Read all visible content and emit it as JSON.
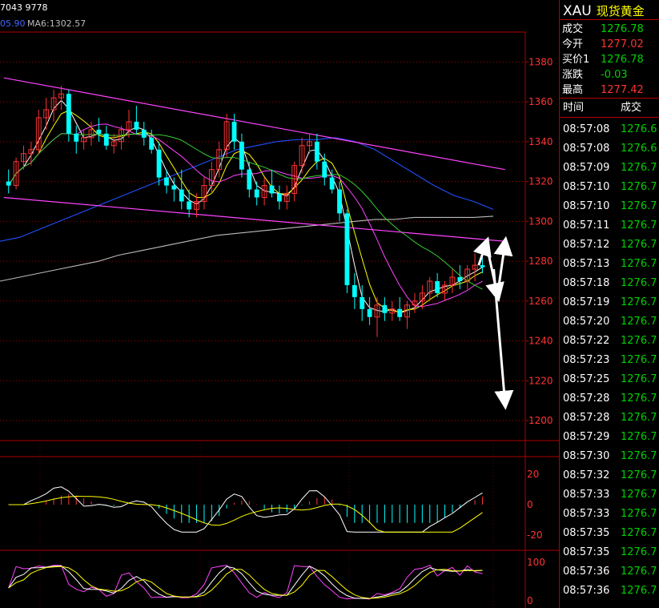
{
  "topbar": {
    "left_text": "7043 9778",
    "ma_partial": "05.90",
    "ma6": "MA6:1302.57"
  },
  "panel": {
    "symbol": "XAU",
    "name": "现货黄金",
    "quotes": [
      {
        "label": "成交",
        "value": "1276.78",
        "color": "#00d000"
      },
      {
        "label": "今开",
        "value": "1277.02",
        "color": "#ff3333"
      },
      {
        "label": "买价1",
        "value": "1276.78",
        "color": "#00d000"
      },
      {
        "label": "涨跌",
        "value": "-0.03",
        "color": "#00d000"
      },
      {
        "label": "最高",
        "value": "1277.42",
        "color": "#ff3333"
      }
    ],
    "tick_header": {
      "time": "时间",
      "price": "成交"
    },
    "ticks": [
      {
        "time": "08:57:08",
        "price": "1276.6"
      },
      {
        "time": "08:57:08",
        "price": "1276.6"
      },
      {
        "time": "08:57:09",
        "price": "1276.7"
      },
      {
        "time": "08:57:10",
        "price": "1276.7"
      },
      {
        "time": "08:57:10",
        "price": "1276.7"
      },
      {
        "time": "08:57:11",
        "price": "1276.7"
      },
      {
        "time": "08:57:12",
        "price": "1276.7"
      },
      {
        "time": "08:57:13",
        "price": "1276.7"
      },
      {
        "time": "08:57:18",
        "price": "1276.7"
      },
      {
        "time": "08:57:19",
        "price": "1276.7"
      },
      {
        "time": "08:57:20",
        "price": "1276.7"
      },
      {
        "time": "08:57:22",
        "price": "1276.7"
      },
      {
        "time": "08:57:23",
        "price": "1276.7"
      },
      {
        "time": "08:57:25",
        "price": "1276.7"
      },
      {
        "time": "08:57:28",
        "price": "1276.7"
      },
      {
        "time": "08:57:28",
        "price": "1276.7"
      },
      {
        "time": "08:57:29",
        "price": "1276.7"
      },
      {
        "time": "08:57:30",
        "price": "1276.7"
      },
      {
        "time": "08:57:32",
        "price": "1276.7"
      },
      {
        "time": "08:57:33",
        "price": "1276.7"
      },
      {
        "time": "08:57:33",
        "price": "1276.7"
      },
      {
        "time": "08:57:35",
        "price": "1276.7"
      },
      {
        "time": "08:57:35",
        "price": "1276.7"
      },
      {
        "time": "08:57:36",
        "price": "1276.7"
      },
      {
        "time": "08:57:36",
        "price": "1276.7"
      }
    ]
  },
  "chart_data": {
    "type": "candlestick",
    "price_axis": {
      "ticks": [
        "1380",
        "1360",
        "1340",
        "1320",
        "1300",
        "1280",
        "1260",
        "1240",
        "1220",
        "1200"
      ],
      "ylim": [
        1190,
        1395
      ]
    },
    "macd_axis": {
      "ticks": [
        "20",
        "0",
        "-20"
      ]
    },
    "osc_axis": {
      "ticks": [
        "100",
        "0"
      ]
    },
    "candles": [
      [
        1320,
        1326,
        1314,
        1318
      ],
      [
        1318,
        1332,
        1316,
        1330
      ],
      [
        1330,
        1338,
        1326,
        1334
      ],
      [
        1334,
        1340,
        1328,
        1336
      ],
      [
        1336,
        1356,
        1334,
        1352
      ],
      [
        1352,
        1362,
        1346,
        1356
      ],
      [
        1356,
        1366,
        1350,
        1362
      ],
      [
        1362,
        1368,
        1356,
        1364
      ],
      [
        1364,
        1366,
        1340,
        1344
      ],
      [
        1344,
        1348,
        1334,
        1340
      ],
      [
        1340,
        1346,
        1336,
        1342
      ],
      [
        1342,
        1350,
        1338,
        1346
      ],
      [
        1346,
        1352,
        1340,
        1344
      ],
      [
        1344,
        1348,
        1336,
        1338
      ],
      [
        1338,
        1344,
        1334,
        1340
      ],
      [
        1340,
        1348,
        1336,
        1346
      ],
      [
        1346,
        1356,
        1342,
        1350
      ],
      [
        1350,
        1358,
        1344,
        1346
      ],
      [
        1346,
        1350,
        1338,
        1342
      ],
      [
        1342,
        1346,
        1334,
        1336
      ],
      [
        1336,
        1340,
        1318,
        1322
      ],
      [
        1322,
        1326,
        1314,
        1318
      ],
      [
        1318,
        1322,
        1310,
        1316
      ],
      [
        1316,
        1326,
        1306,
        1310
      ],
      [
        1310,
        1316,
        1302,
        1306
      ],
      [
        1306,
        1314,
        1302,
        1310
      ],
      [
        1310,
        1322,
        1306,
        1318
      ],
      [
        1318,
        1330,
        1314,
        1326
      ],
      [
        1326,
        1340,
        1322,
        1336
      ],
      [
        1336,
        1354,
        1332,
        1350
      ],
      [
        1350,
        1354,
        1336,
        1340
      ],
      [
        1340,
        1344,
        1322,
        1326
      ],
      [
        1326,
        1330,
        1312,
        1316
      ],
      [
        1316,
        1320,
        1308,
        1312
      ],
      [
        1312,
        1322,
        1308,
        1318
      ],
      [
        1318,
        1326,
        1312,
        1314
      ],
      [
        1314,
        1318,
        1306,
        1310
      ],
      [
        1310,
        1318,
        1306,
        1314
      ],
      [
        1314,
        1330,
        1310,
        1328
      ],
      [
        1328,
        1342,
        1324,
        1338
      ],
      [
        1338,
        1344,
        1334,
        1340
      ],
      [
        1340,
        1344,
        1326,
        1330
      ],
      [
        1330,
        1334,
        1318,
        1322
      ],
      [
        1322,
        1326,
        1314,
        1316
      ],
      [
        1316,
        1320,
        1300,
        1304
      ],
      [
        1304,
        1306,
        1264,
        1268
      ],
      [
        1268,
        1274,
        1256,
        1262
      ],
      [
        1262,
        1268,
        1250,
        1256
      ],
      [
        1256,
        1262,
        1248,
        1252
      ],
      [
        1252,
        1262,
        1242,
        1258
      ],
      [
        1258,
        1262,
        1250,
        1254
      ],
      [
        1254,
        1260,
        1250,
        1256
      ],
      [
        1256,
        1262,
        1250,
        1252
      ],
      [
        1252,
        1260,
        1246,
        1258
      ],
      [
        1258,
        1264,
        1254,
        1260
      ],
      [
        1260,
        1268,
        1256,
        1264
      ],
      [
        1264,
        1272,
        1260,
        1270
      ],
      [
        1270,
        1274,
        1262,
        1264
      ],
      [
        1264,
        1270,
        1260,
        1268
      ],
      [
        1268,
        1276,
        1264,
        1272
      ],
      [
        1272,
        1278,
        1266,
        1270
      ],
      [
        1270,
        1278,
        1266,
        1276
      ],
      [
        1276,
        1284,
        1270,
        1278
      ],
      [
        1278,
        1282,
        1274,
        1277
      ]
    ],
    "trendlines": [
      {
        "from": [
          0,
          1372
        ],
        "to": [
          66,
          1326
        ],
        "color": "#ff44ff"
      },
      {
        "from": [
          0,
          1312
        ],
        "to": [
          66,
          1290
        ],
        "color": "#ff44ff"
      }
    ],
    "forecast_arrows": [
      {
        "from": [
          1278,
          62.5
        ],
        "to": [
          1289,
          63.5
        ]
      },
      {
        "from": [
          1289,
          63.5
        ],
        "to": [
          1263,
          65
        ]
      },
      {
        "from": [
          1263,
          65
        ],
        "to": [
          1289,
          66
        ]
      },
      {
        "from": [
          1276,
          64.5
        ],
        "to": [
          1209,
          66
        ]
      }
    ],
    "ma_lines": [
      {
        "name": "MA6",
        "color": "#bbbbbb",
        "values": [
          1270,
          1272,
          1274,
          1276,
          1278,
          1280,
          1283,
          1285,
          1287,
          1289,
          1291,
          1293,
          1294,
          1295,
          1296,
          1297,
          1298,
          1299,
          1300,
          1301,
          1301,
          1302,
          1302,
          1302,
          1302,
          1302.57
        ]
      },
      {
        "name": "",
        "color": "#2050ff",
        "values": [
          1290,
          1292,
          1296,
          1300,
          1304,
          1308,
          1312,
          1316,
          1320,
          1324,
          1328,
          1332,
          1336,
          1338,
          1340,
          1341,
          1341,
          1342,
          1340,
          1336,
          1330,
          1324,
          1318,
          1313,
          1310,
          1306
        ]
      }
    ]
  }
}
